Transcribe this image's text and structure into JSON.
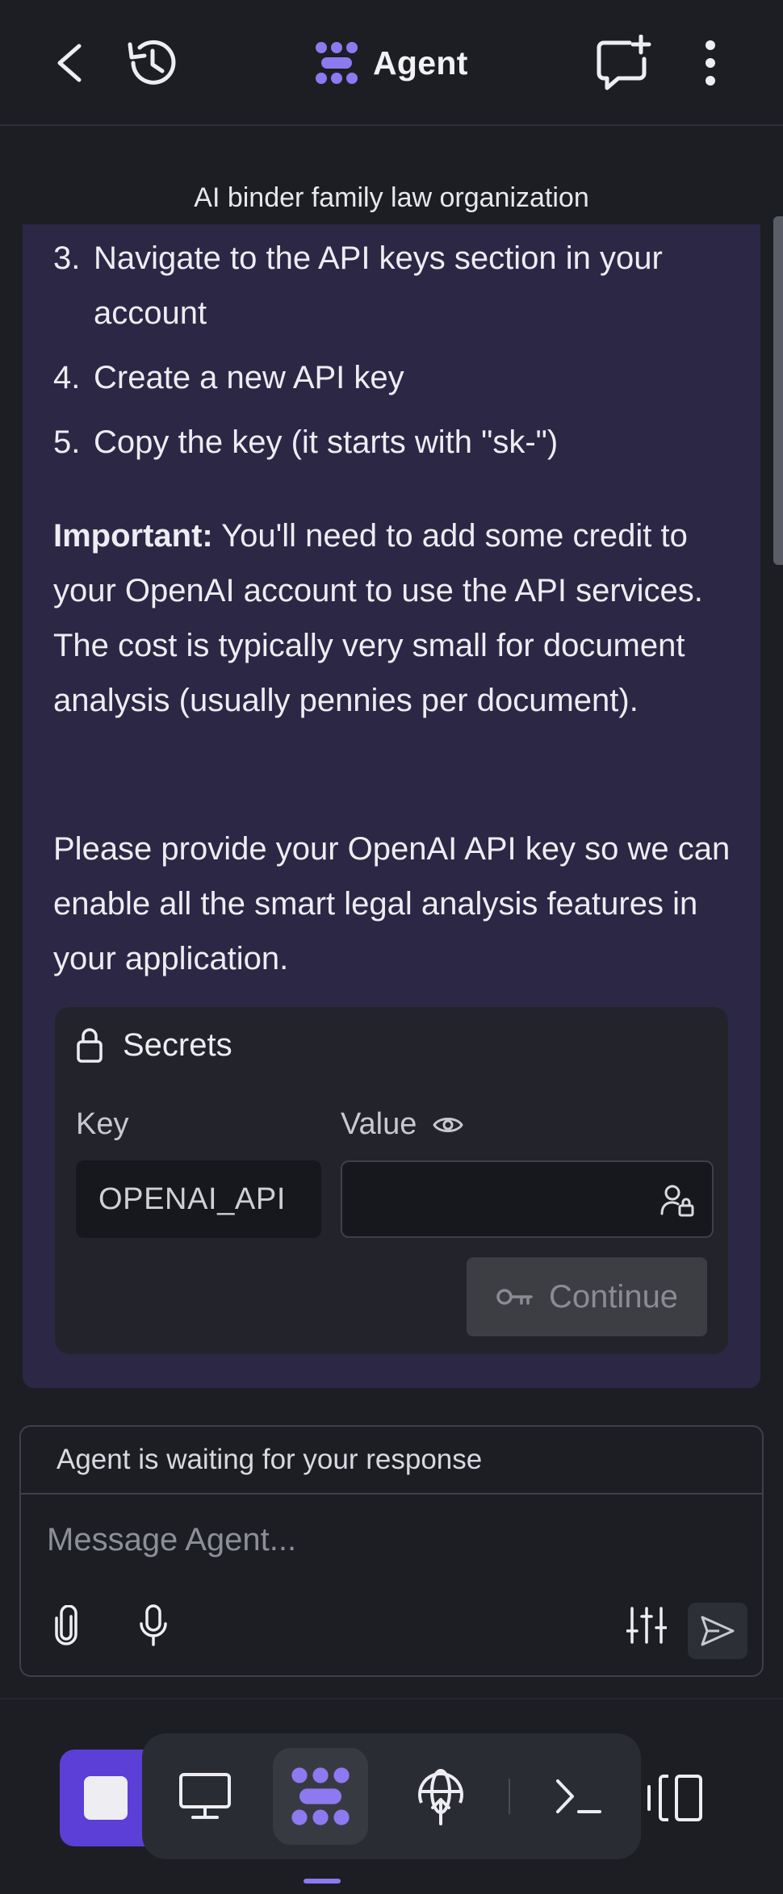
{
  "header": {
    "title": "Agent",
    "icons": [
      "back-arrow-icon",
      "history-icon",
      "agent-logo-icon",
      "new-chat-icon",
      "more-vertical-icon"
    ]
  },
  "chat": {
    "title": "AI binder family law organization",
    "steps": [
      {
        "num": "3.",
        "text": "Navigate to the API keys section in your account"
      },
      {
        "num": "4.",
        "text": "Create a new API key"
      },
      {
        "num": "5.",
        "text": "Copy the key (it starts with \"sk-\")"
      }
    ],
    "important_label": "Important:",
    "important_text": " You'll need to add some credit to your OpenAI account to use the API services. The cost is typically very small for document analysis (usually pennies per document).",
    "request_text": "Please provide your OpenAI API key so we can enable all the smart legal analysis features in your application."
  },
  "secrets": {
    "title": "Secrets",
    "key_label": "Key",
    "value_label": "Value",
    "key_value": "OPENAI_API",
    "value_value": "",
    "continue_label": "Continue"
  },
  "composer": {
    "status": "Agent is waiting for your response",
    "placeholder": "Message Agent..."
  },
  "colors": {
    "accent": "#5b3fd6",
    "logo": "#8d79f0",
    "bubble": "#2b2745",
    "background": "#1c1e24"
  }
}
